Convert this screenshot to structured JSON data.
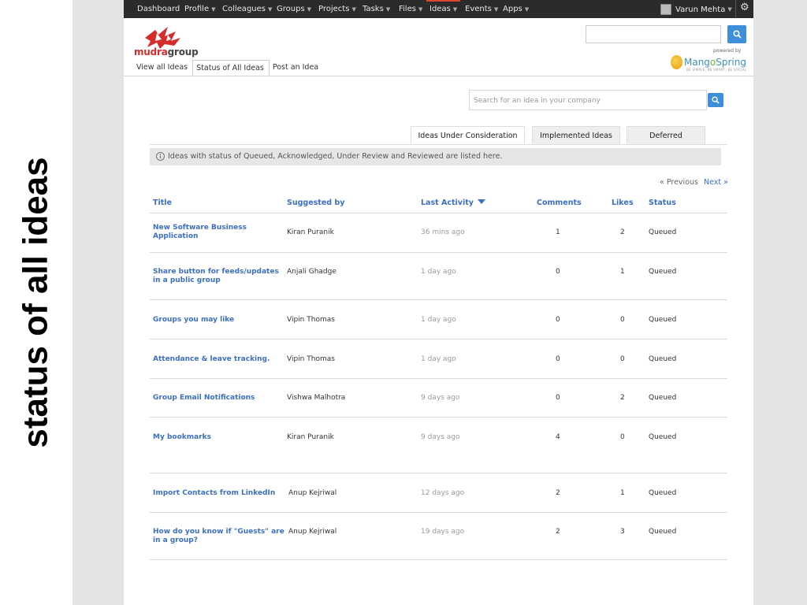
{
  "slide_title": "status of all ideas",
  "nav": {
    "items": [
      "Dashboard",
      "Profile",
      "Colleagues",
      "Groups",
      "Projects",
      "Tasks",
      "Files",
      "Ideas",
      "Events",
      "Apps"
    ],
    "user_name": "Varun Mehta"
  },
  "brand": {
    "logo_part1": "mudra",
    "logo_part2": "group",
    "powered_by": "powered by",
    "platform_part1": "Mang",
    "platform_part2": "o",
    "platform_part3": "Spring",
    "platform_tagline": "BE SIMPLE, BE SMART, BE SOCIAL"
  },
  "subtabs": [
    "View all Ideas",
    "Status of All Ideas",
    "Post an Idea"
  ],
  "idea_search": {
    "placeholder": "Search for an idea in your company"
  },
  "status_tabs": [
    "Ideas Under Consideration",
    "Implemented Ideas",
    "Deferred"
  ],
  "info_text": "Ideas with status of Queued, Acknowledged, Under Review and Reviewed are listed here.",
  "pager": {
    "prev": "« Previous",
    "next": "Next »"
  },
  "table": {
    "headers": {
      "title": "Title",
      "suggested_by": "Suggested by",
      "last_activity": "Last Activity",
      "comments": "Comments",
      "likes": "Likes",
      "status": "Status"
    },
    "rows": [
      {
        "title": "New Software Business Application",
        "suggested_by": "Kiran Puranik",
        "last_activity": "36 mins ago",
        "comments": "1",
        "likes": "2",
        "status": "Queued"
      },
      {
        "title": "Share button for feeds/updates in a public group",
        "suggested_by": "Anjali Ghadge",
        "last_activity": "1 day ago",
        "comments": "0",
        "likes": "1",
        "status": "Queued"
      },
      {
        "title": "Groups you may like",
        "suggested_by": "Vipin Thomas",
        "last_activity": "1 day ago",
        "comments": "0",
        "likes": "0",
        "status": "Queued"
      },
      {
        "title": "Attendance & leave tracking.",
        "suggested_by": "Vipin Thomas",
        "last_activity": "1 day ago",
        "comments": "0",
        "likes": "0",
        "status": "Queued"
      },
      {
        "title": "Group Email Notifications",
        "suggested_by": "Vishwa Malhotra",
        "last_activity": "9 days ago",
        "comments": "0",
        "likes": "2",
        "status": "Queued"
      },
      {
        "title": "My bookmarks",
        "suggested_by": "Kiran Puranik",
        "last_activity": "9 days ago",
        "comments": "4",
        "likes": "0",
        "status": "Queued"
      },
      {
        "title": "Import Contacts from LinkedIn",
        "suggested_by": "Anup Kejriwal",
        "last_activity": "12 days ago",
        "comments": "2",
        "likes": "1",
        "status": "Queued"
      },
      {
        "title": "How do you know if \"Guests\" are in a group?",
        "suggested_by": "Anup Kejriwal",
        "last_activity": "19 days ago",
        "comments": "2",
        "likes": "3",
        "status": "Queued"
      }
    ]
  },
  "colors": {
    "nav_bg": "#2b2b2b",
    "link_blue": "#3b6fc4",
    "button_blue": "#3e8edc",
    "active_nav_marker": "#e0452f",
    "logo_red": "#d62b2b"
  }
}
